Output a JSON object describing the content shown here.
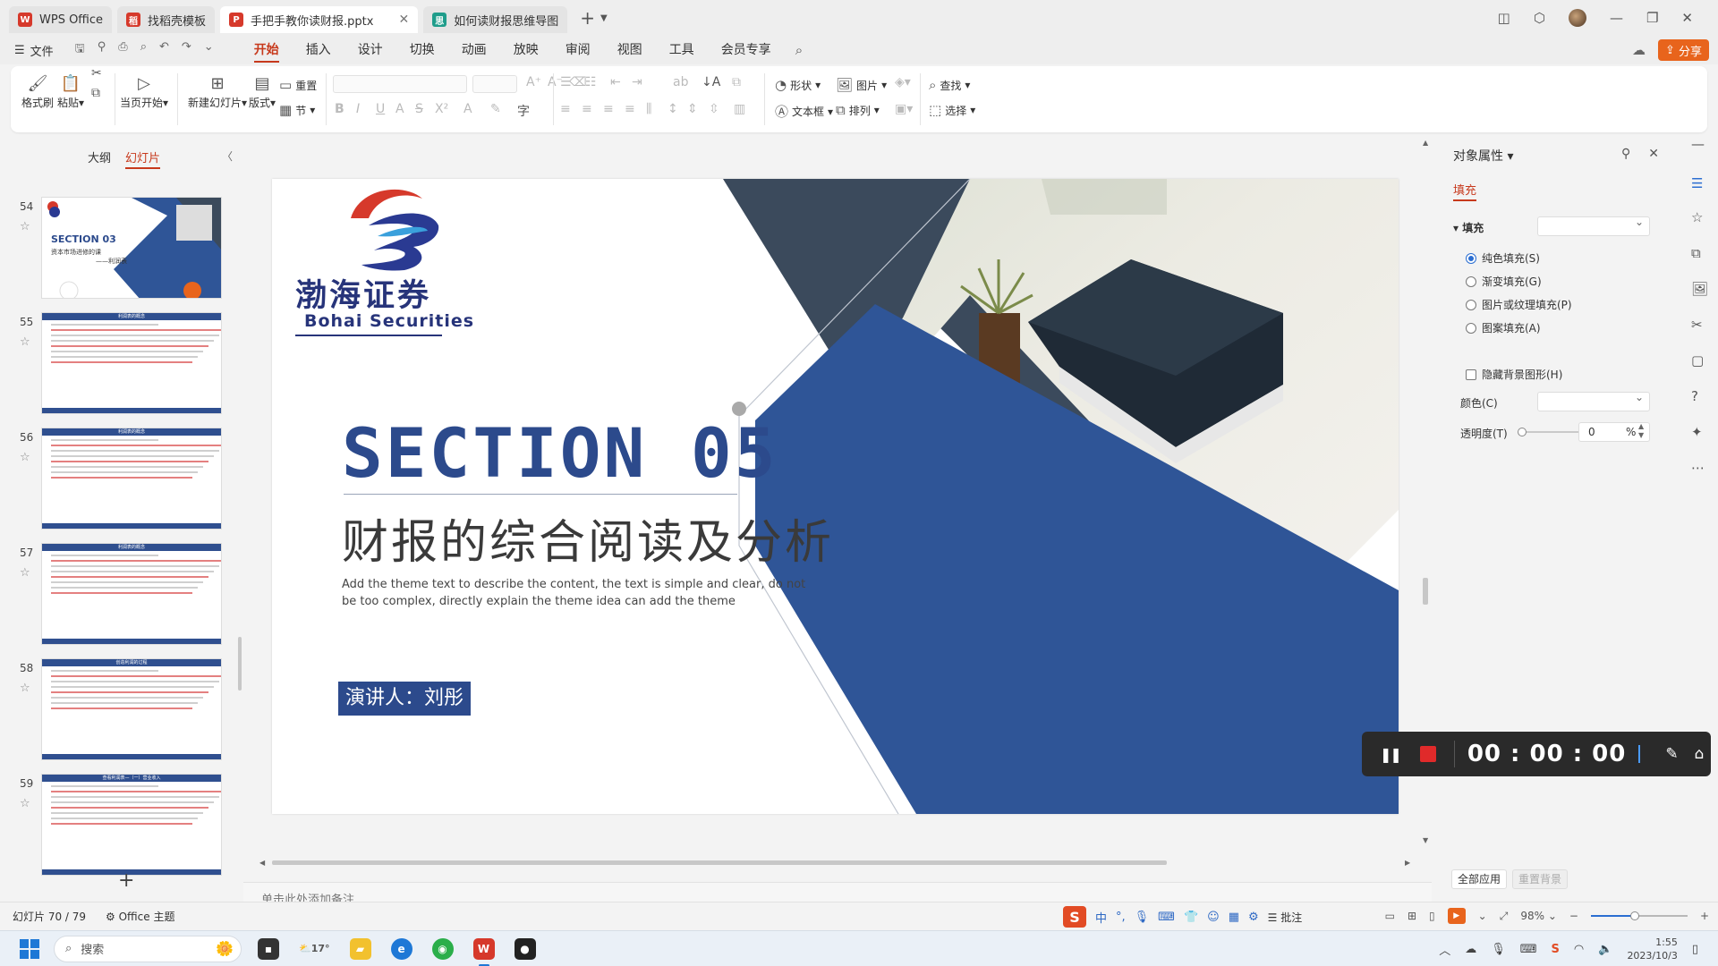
{
  "tabs": [
    {
      "label": "WPS Office",
      "logo": "W",
      "color": "#d6392b",
      "state": "inactive"
    },
    {
      "label": "找稻壳模板",
      "logo": "稻",
      "color": "#d6392b",
      "state": "inactive"
    },
    {
      "label": "手把手教你读财报.pptx",
      "logo": "P",
      "color": "#d6392b",
      "state": "active"
    },
    {
      "label": "如何读财报思维导图",
      "logo": "思",
      "color": "#1f9d8b",
      "state": "inactive"
    }
  ],
  "menu": {
    "file": "文件",
    "tabs": [
      "开始",
      "插入",
      "设计",
      "切换",
      "动画",
      "放映",
      "审阅",
      "视图",
      "工具",
      "会员专享"
    ],
    "active_tab": "开始",
    "share": "分享"
  },
  "ribbon": {
    "format_painter": "格式刷",
    "paste": "粘贴",
    "from_current": "当页开始",
    "new_slide": "新建幻灯片",
    "layout": "版式",
    "reset": "重置",
    "section": "节",
    "shape": "形状",
    "picture": "图片",
    "textbox": "文本框",
    "arrange": "排列",
    "find": "查找",
    "select": "选择"
  },
  "left_panel": {
    "tab_outline": "大纲",
    "tab_slides": "幻灯片",
    "thumbnails": [
      {
        "num": "54",
        "kind": "section",
        "title": "SECTION  03",
        "sub1": "资本市场进修的课",
        "sub2": "——利润表"
      },
      {
        "num": "55",
        "kind": "content",
        "header": "利润表的概念"
      },
      {
        "num": "56",
        "kind": "table",
        "header": "利润表的概念"
      },
      {
        "num": "57",
        "kind": "content",
        "header": "利润表的概念"
      },
      {
        "num": "58",
        "kind": "content",
        "header": "创造利润的过程"
      },
      {
        "num": "59",
        "kind": "diagram",
        "header": "查看利润表—（一）营业收入"
      }
    ]
  },
  "slide": {
    "logo_cn": "渤海证券",
    "logo_en": "Bohai Securities",
    "section_title": "SECTION 05",
    "subtitle": "财报的综合阅读及分析",
    "description": "Add the theme text to describe the content, the text is simple and clear, do not be too complex, directly explain the theme idea can add the theme",
    "presenter": "演讲人：刘彤"
  },
  "notes_placeholder": "单击此处添加备注",
  "right_panel": {
    "title": "对象属性",
    "subtab": "填充",
    "fill_label": "填充",
    "options": [
      "纯色填充(S)",
      "渐变填充(G)",
      "图片或纹理填充(P)",
      "图案填充(A)"
    ],
    "selected_option": 0,
    "hide_bg": "隐藏背景图形(H)",
    "color_label": "颜色(C)",
    "transparency_label": "透明度(T)",
    "transparency_value": "0",
    "transparency_unit": "%",
    "apply_all": "全部应用",
    "reset_bg": "重置背景"
  },
  "timer": {
    "time": "00 : 00 : 00"
  },
  "status": {
    "slide_count": "幻灯片 70 / 79",
    "theme": "Office 主题",
    "comment": "批注",
    "zoom": "98%",
    "zoom_fraction": 0.45
  },
  "taskbar": {
    "search": "搜索",
    "weather": "17°",
    "clock_time": "1:55",
    "clock_date": "2023/10/3"
  },
  "colors": {
    "accent": "#c7391c",
    "brand_blue": "#2c4a8c",
    "dark_navy": "#3b4a5c"
  }
}
